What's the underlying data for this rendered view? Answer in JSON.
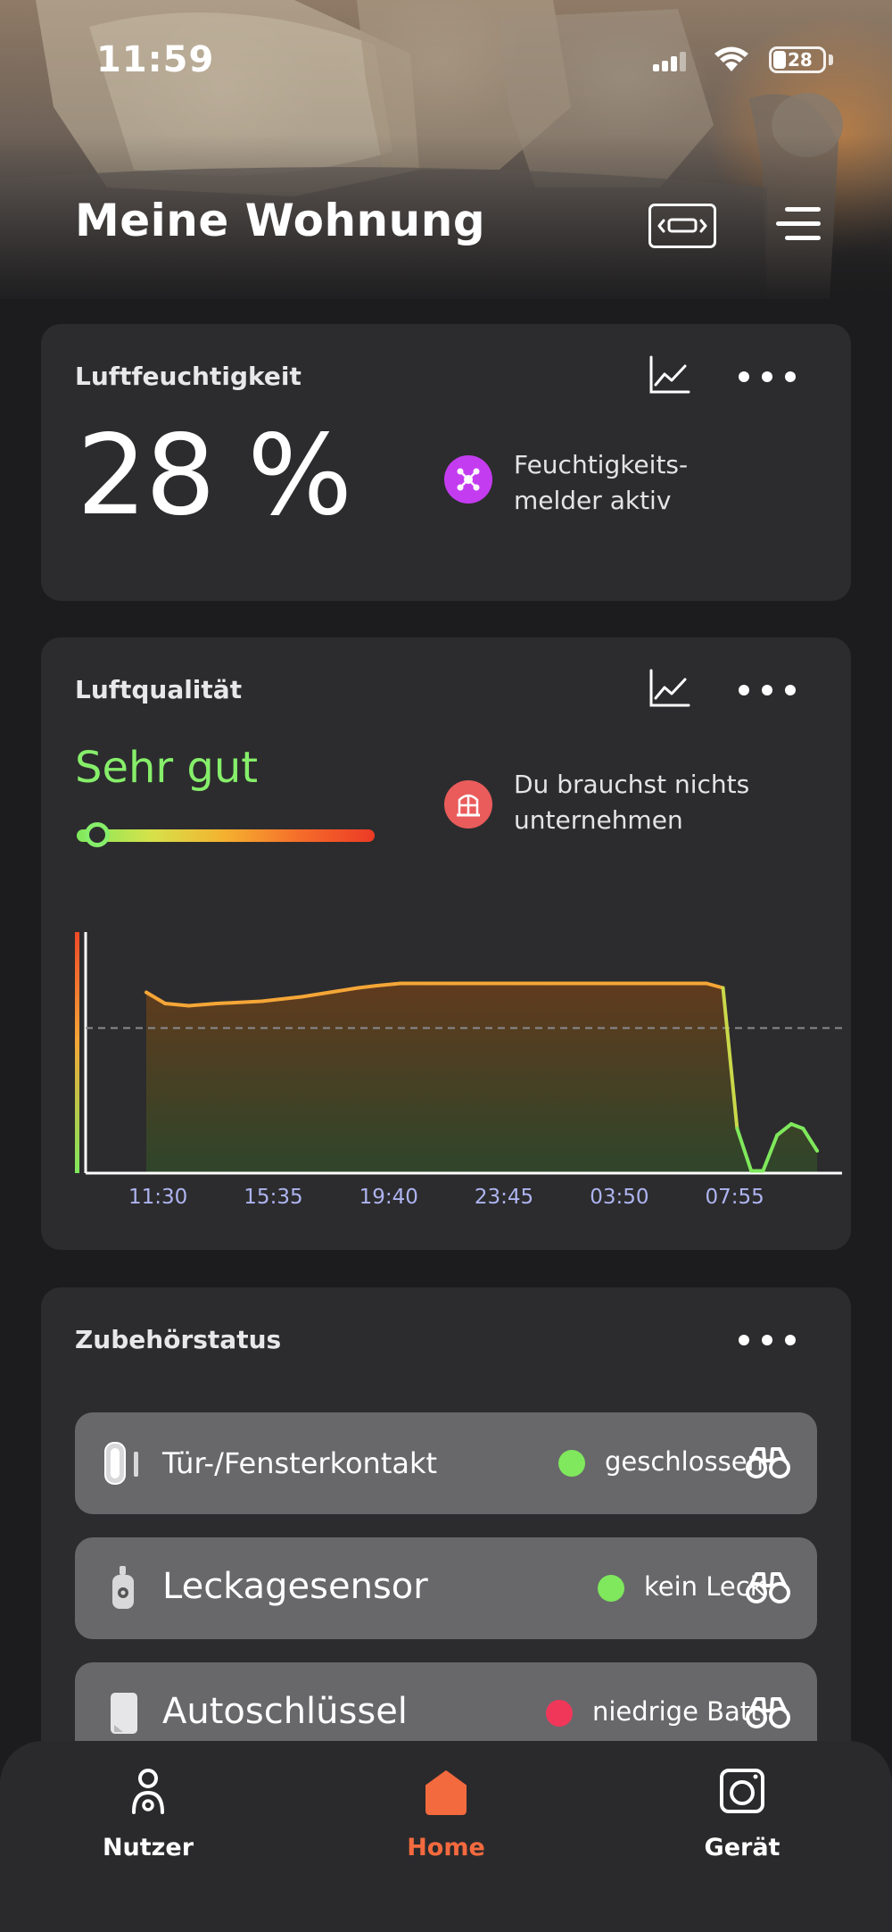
{
  "status_bar": {
    "time": "11:59",
    "battery": "28"
  },
  "header": {
    "title": "Meine Wohnung",
    "remote_icon": "remote-control-icon",
    "menu_icon": "menu-icon"
  },
  "humidity_card": {
    "title": "Luftfeuchtigkeit",
    "value": "28 %",
    "note": "Feuchtigkeits-\nmelder aktiv",
    "note_icon": "dehumidifier-icon",
    "note_icon_color": "#c43cf0"
  },
  "air_quality_card": {
    "title": "Luftqualität",
    "level": "Sehr gut",
    "level_color": "#86ee6a",
    "level_fraction": 0.07,
    "note": "Du brauchst nichts\nunternehmen",
    "note_icon": "window-icon",
    "note_icon_color": "#ea5b5b"
  },
  "chart_data": {
    "type": "area",
    "title": "",
    "xlabel": "",
    "ylabel": "",
    "x_ticks": [
      "11:30",
      "15:35",
      "19:40",
      "23:45",
      "03:50",
      "07:55"
    ],
    "x": [
      "11:30",
      "12:10",
      "13:00",
      "14:00",
      "15:35",
      "17:00",
      "18:00",
      "19:00",
      "19:40",
      "20:30",
      "22:00",
      "23:45",
      "01:00",
      "02:30",
      "03:50",
      "05:00",
      "06:30",
      "07:20",
      "07:55",
      "08:25",
      "08:55",
      "09:20",
      "09:50",
      "10:20",
      "10:45",
      "11:15"
    ],
    "series": [
      {
        "values": [
          81,
          76,
          75,
          76,
          77,
          79,
          81,
          83,
          84,
          85,
          85,
          85,
          85,
          85,
          85,
          85,
          85,
          85,
          83,
          20,
          1,
          1,
          17,
          22,
          20,
          10
        ]
      }
    ],
    "ylim": [
      0,
      100
    ],
    "reference_line": 65,
    "colors": {
      "high": "#f5a637",
      "low": "#7fe85c",
      "fill_top": "#6a3d1a",
      "fill_bottom": "#2f4a2a",
      "axis": "#ffffff",
      "dashed": "#8a8a8e"
    },
    "grid": false,
    "legend": "none"
  },
  "accessory_card": {
    "title": "Zubehörstatus",
    "items": [
      {
        "name": "Tür-/Fensterkontakt",
        "status": "geschlossen",
        "status_color": "#7fe85c",
        "icon": "door-window-contact-icon"
      },
      {
        "name": "Leckagesensor",
        "status": "kein Leck",
        "status_color": "#7fe85c",
        "icon": "leak-sensor-icon"
      },
      {
        "name": "Autoschlüssel",
        "status": "niedrige Batt.",
        "status_color": "#f0375a",
        "icon": "car-key-tracker-icon"
      }
    ]
  },
  "bottom_nav": {
    "items": [
      {
        "label": "Nutzer",
        "icon": "user-icon"
      },
      {
        "label": "Home",
        "icon": "home-icon"
      },
      {
        "label": "Gerät",
        "icon": "device-icon"
      }
    ],
    "active_color": "#f46a3f"
  }
}
